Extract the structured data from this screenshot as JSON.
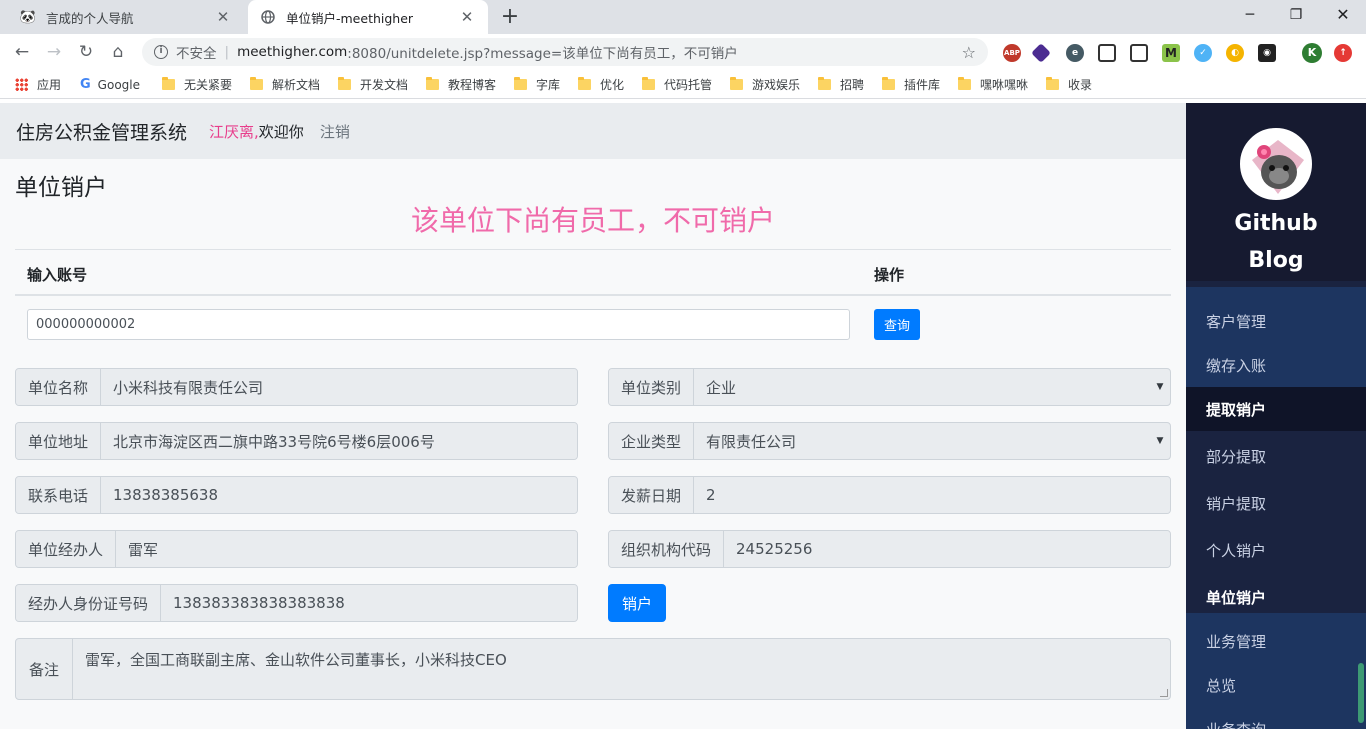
{
  "browser": {
    "tabs": [
      {
        "title": "言成的个人导航",
        "active": false
      },
      {
        "title": "单位销户-meethigher",
        "active": true
      }
    ],
    "address": {
      "security_text": "不安全",
      "host": "meethigher.com",
      "path": ":8080/unitdelete.jsp?message=该单位下尚有员工，不可销户"
    },
    "bookmarks": [
      "应用",
      "Google",
      "无关紧要",
      "解析文档",
      "开发文档",
      "教程博客",
      "字库",
      "优化",
      "代码托管",
      "游戏娱乐",
      "招聘",
      "插件库",
      "嘿咻嘿咻",
      "收录"
    ],
    "profile_initial": "K"
  },
  "header": {
    "app_name": "住房公积金管理系统",
    "user_name": "江厌离,",
    "welcome": "欢迎你",
    "logout": "注销"
  },
  "main": {
    "page_title": "单位销户",
    "message": "该单位下尚有员工，不可销户",
    "query": {
      "col_account": "输入账号",
      "col_action": "操作",
      "account_value": "000000000002",
      "button": "查询"
    },
    "fields": {
      "unit_name": {
        "label": "单位名称",
        "value": "小米科技有限责任公司"
      },
      "unit_type": {
        "label": "单位类别",
        "value": "企业"
      },
      "unit_address": {
        "label": "单位地址",
        "value": "北京市海淀区西二旗中路33号院6号楼6层006号"
      },
      "enterprise_type": {
        "label": "企业类型",
        "value": "有限责任公司"
      },
      "phone": {
        "label": "联系电话",
        "value": "13838385638"
      },
      "pay_date": {
        "label": "发薪日期",
        "value": "2"
      },
      "agent": {
        "label": "单位经办人",
        "value": "雷军"
      },
      "org_code": {
        "label": "组织机构代码",
        "value": "24525256"
      },
      "agent_id": {
        "label": "经办人身份证号码",
        "value": "138383383838383838"
      },
      "remark": {
        "label": "备注",
        "value": "雷军，全国工商联副主席、金山软件公司董事长，小米科技CEO"
      }
    },
    "cancel_button": "销户"
  },
  "sidebar": {
    "blog_line1": "Github",
    "blog_line2": "Blog",
    "items": [
      "客户管理",
      "缴存入账",
      "提取销户",
      "部分提取",
      "销户提取",
      "个人销户",
      "单位销户",
      "业务管理",
      "总览",
      "业务查询"
    ]
  },
  "colors": {
    "primary": "#007bff",
    "message": "#f06aaa",
    "sidebar_bg": "#1a2340"
  }
}
